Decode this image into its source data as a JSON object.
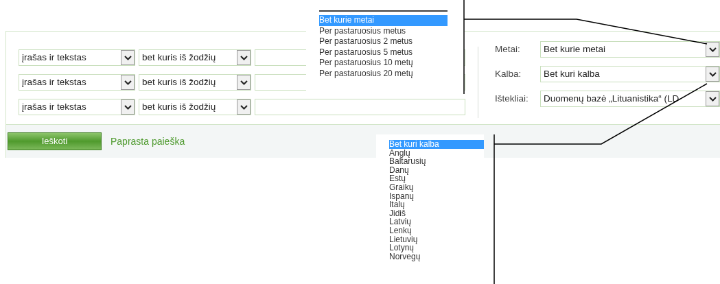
{
  "search_rows": [
    {
      "field": "įrašas ir tekstas",
      "operator": "bet kuris iš žodžių"
    },
    {
      "field": "įrašas ir tekstas",
      "operator": "bet kuris iš žodžių"
    },
    {
      "field": "įrašas ir tekstas",
      "operator": "bet kuris iš žodžių"
    }
  ],
  "filters": [
    {
      "label": "Metai:",
      "value": "Bet kurie metai"
    },
    {
      "label": "Kalba:",
      "value": "Bet kuri kalba"
    },
    {
      "label": "Ištekliai:",
      "value": "Duomenų bazė „Lituanistika“ (LD"
    }
  ],
  "search_button": "Ieškoti",
  "simple_search_link": "Paprasta paieška",
  "year_dropdown": {
    "options": [
      {
        "label": "Bet kurie metai",
        "selected": true
      },
      {
        "label": "Per pastaruosius metus",
        "selected": false
      },
      {
        "label": "Per pastaruosius 2 metus",
        "selected": false
      },
      {
        "label": "Per pastaruosius 5 metus",
        "selected": false
      },
      {
        "label": "Per pastaruosius 10 metų",
        "selected": false
      },
      {
        "label": "Per pastaruosius 20 metų",
        "selected": false
      }
    ]
  },
  "language_dropdown": {
    "options": [
      {
        "label": "Bet kuri kalba",
        "selected": true
      },
      {
        "label": "Anglų",
        "selected": false
      },
      {
        "label": "Baltarusių",
        "selected": false
      },
      {
        "label": "Danų",
        "selected": false
      },
      {
        "label": "Estų",
        "selected": false
      },
      {
        "label": "Graikų",
        "selected": false
      },
      {
        "label": "Ispanų",
        "selected": false
      },
      {
        "label": "Italų",
        "selected": false
      },
      {
        "label": "Jidiš",
        "selected": false
      },
      {
        "label": "Latvių",
        "selected": false
      },
      {
        "label": "Lenkų",
        "selected": false
      },
      {
        "label": "Lietuvių",
        "selected": false
      },
      {
        "label": "Lotynų",
        "selected": false
      },
      {
        "label": "Norvegų",
        "selected": false
      }
    ]
  }
}
